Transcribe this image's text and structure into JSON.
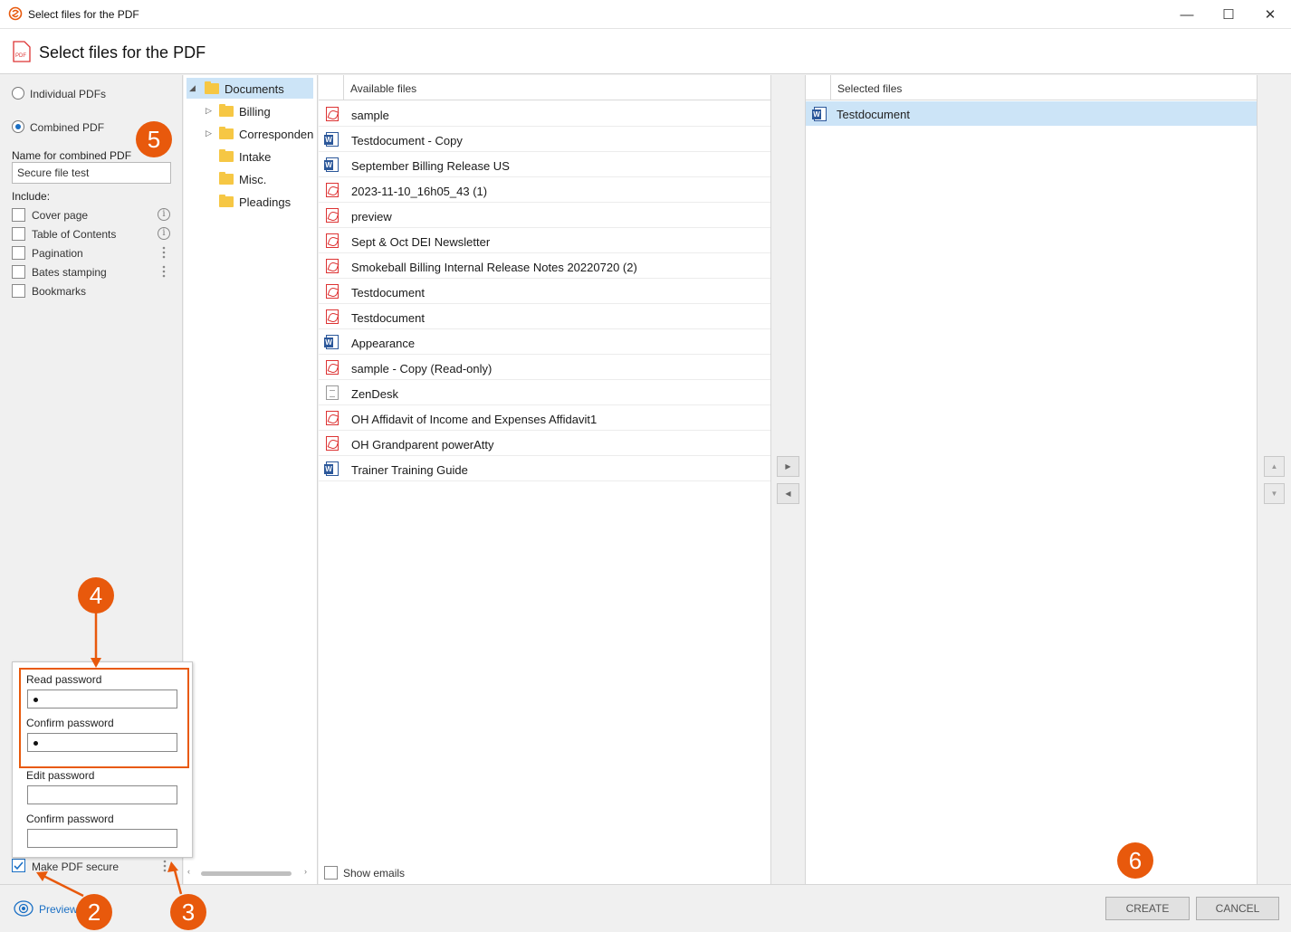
{
  "window": {
    "title": "Select files for the PDF",
    "min_glyph": "—",
    "max_glyph": "☐",
    "close_glyph": "✕"
  },
  "header": {
    "title": "Select files for the PDF"
  },
  "options": {
    "individual_label": "Individual PDFs",
    "combined_label": "Combined PDF",
    "selected_mode": "combined",
    "name_label": "Name for combined PDF",
    "name_value": "Secure file test",
    "include_label": "Include:",
    "include_items": [
      {
        "label": "Cover page",
        "checked": false,
        "extra": "info"
      },
      {
        "label": "Table of Contents",
        "checked": false,
        "extra": "info"
      },
      {
        "label": "Pagination",
        "checked": false,
        "extra": "more"
      },
      {
        "label": "Bates stamping",
        "checked": false,
        "extra": "more"
      },
      {
        "label": "Bookmarks",
        "checked": false,
        "extra": ""
      }
    ],
    "make_secure_label": "Make PDF secure",
    "make_secure_checked": true
  },
  "security_popup": {
    "read_password_label": "Read password",
    "confirm_password_label_1": "Confirm password",
    "edit_password_label": "Edit password",
    "confirm_password_label_2": "Confirm password"
  },
  "tree": {
    "root": "Documents",
    "children": [
      {
        "label": "Billing",
        "expandable": true
      },
      {
        "label": "Corresponden",
        "expandable": true
      },
      {
        "label": "Intake",
        "expandable": false
      },
      {
        "label": "Misc.",
        "expandable": false
      },
      {
        "label": "Pleadings",
        "expandable": false
      }
    ]
  },
  "available": {
    "header": "Available files",
    "files": [
      {
        "name": "sample",
        "type": "pdf"
      },
      {
        "name": "Testdocument - Copy",
        "type": "word"
      },
      {
        "name": "September Billing Release US",
        "type": "word"
      },
      {
        "name": "2023-11-10_16h05_43 (1)",
        "type": "pdf"
      },
      {
        "name": "preview",
        "type": "pdf"
      },
      {
        "name": "Sept & Oct DEI Newsletter",
        "type": "pdf"
      },
      {
        "name": "Smokeball Billing Internal Release Notes 20220720 (2)",
        "type": "pdf"
      },
      {
        "name": "Testdocument",
        "type": "pdf"
      },
      {
        "name": "Testdocument",
        "type": "pdf"
      },
      {
        "name": "Appearance",
        "type": "word"
      },
      {
        "name": "sample - Copy (Read-only)",
        "type": "pdf"
      },
      {
        "name": "ZenDesk",
        "type": "generic"
      },
      {
        "name": "OH Affidavit of Income and Expenses Affidavit1",
        "type": "pdf"
      },
      {
        "name": "OH Grandparent powerAtty",
        "type": "pdf"
      },
      {
        "name": "Trainer Training Guide",
        "type": "word"
      }
    ],
    "show_emails_label": "Show emails"
  },
  "selected": {
    "header": "Selected files",
    "files": [
      {
        "name": "Testdocument",
        "type": "word"
      }
    ]
  },
  "footer": {
    "preview_label": "Preview",
    "create_label": "CREATE",
    "cancel_label": "CANCEL"
  },
  "callouts": [
    "2",
    "3",
    "4",
    "5",
    "6"
  ],
  "colors": {
    "accent": "#e8590c",
    "selection": "#cce4f7",
    "link": "#1a6fc4"
  }
}
